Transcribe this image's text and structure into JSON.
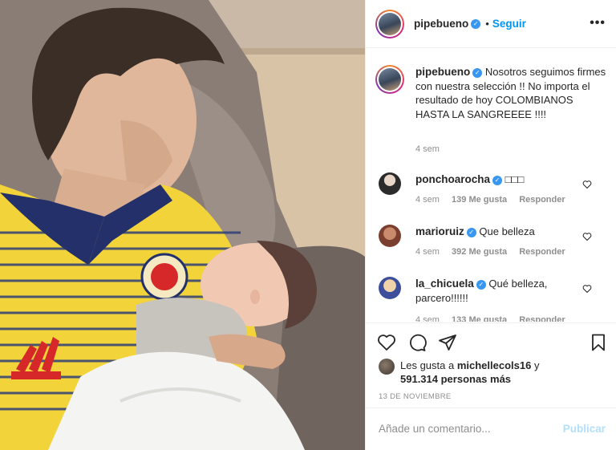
{
  "post": {
    "author": {
      "username": "pipebueno",
      "verified": true,
      "follow_label": "Seguir",
      "more_label": "•••"
    },
    "caption": {
      "text": "Nosotros seguimos firmes con nuestra selección !! No importa el resultado de hoy COLOMBIANOS HASTA LA SANGREEEE !!!!",
      "time": "4 sem"
    },
    "comments": [
      {
        "username": "ponchoarocha",
        "verified": true,
        "text": "□□□",
        "time": "4 sem",
        "likes": "139 Me gusta",
        "reply": "Responder",
        "avatar_color": "#2b2b2b"
      },
      {
        "username": "marioruiz",
        "verified": true,
        "text": "Que belleza",
        "time": "4 sem",
        "likes": "392 Me gusta",
        "reply": "Responder",
        "avatar_color": "#8a4a3a"
      },
      {
        "username": "la_chicuela",
        "verified": true,
        "text": "Qué belleza, parcero!!!!!!",
        "time": "4 sem",
        "likes": "133 Me gusta",
        "reply": "Responder",
        "avatar_color": "#4a5fa8"
      }
    ],
    "likes": {
      "prefix": "Les gusta a",
      "user": "michellecols16",
      "conjunction": "y",
      "others": "591.314 personas más"
    },
    "date": "13 DE NOVIEMBRE",
    "comment_input": {
      "placeholder": "Añade un comentario...",
      "publish_label": "Publicar"
    },
    "icons": [
      "heart-icon",
      "comment-icon",
      "share-icon",
      "bookmark-icon"
    ],
    "colors": {
      "accent": "#0095f6",
      "verified": "#3897f0",
      "muted": "#8e8e8e",
      "publish_disabled": "#b2dffc"
    }
  }
}
